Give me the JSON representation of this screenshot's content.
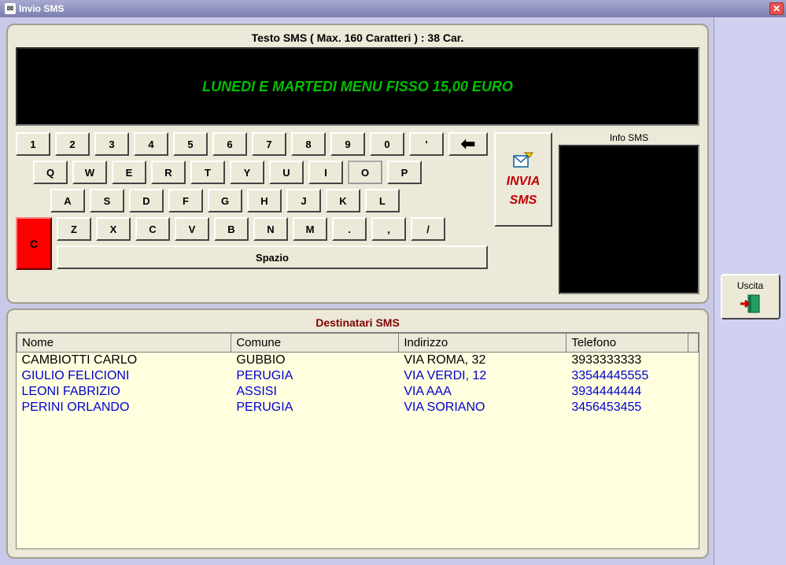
{
  "window": {
    "title": "Invio SMS"
  },
  "sms": {
    "header": "Testo SMS ( Max. 160 Caratteri ) : 38 Car.",
    "text": "LUNEDI E MARTEDI MENU FISSO 15,00 EURO"
  },
  "keyboard": {
    "row1": [
      "1",
      "2",
      "3",
      "4",
      "5",
      "6",
      "7",
      "8",
      "9",
      "0",
      "'"
    ],
    "row2": [
      "Q",
      "W",
      "E",
      "R",
      "T",
      "Y",
      "U",
      "I",
      "O",
      "P"
    ],
    "row3": [
      "A",
      "S",
      "D",
      "F",
      "G",
      "H",
      "J",
      "K",
      "L"
    ],
    "row4": [
      "Z",
      "X",
      "C",
      "V",
      "B",
      "N",
      "M",
      ".",
      ",",
      "/"
    ],
    "c_key": "C",
    "space": "Spazio",
    "focused_key": "O"
  },
  "send": {
    "line1": "INVIA",
    "line2": "SMS"
  },
  "info": {
    "label": "Info SMS"
  },
  "recipients": {
    "title": "Destinatari SMS",
    "columns": [
      "Nome",
      "Comune",
      "Indirizzo",
      "Telefono"
    ],
    "rows": [
      {
        "nome": "CAMBIOTTI CARLO",
        "comune": "GUBBIO",
        "indirizzo": "VIA ROMA, 32",
        "telefono": "3933333333",
        "selected": true
      },
      {
        "nome": "GIULIO FELICIONI",
        "comune": "PERUGIA",
        "indirizzo": "VIA VERDI, 12",
        "telefono": "33544445555",
        "selected": false
      },
      {
        "nome": "LEONI FABRIZIO",
        "comune": "ASSISI",
        "indirizzo": "VIA AAA",
        "telefono": "3934444444",
        "selected": false
      },
      {
        "nome": "PERINI ORLANDO",
        "comune": "PERUGIA",
        "indirizzo": "VIA SORIANO",
        "telefono": "3456453455",
        "selected": false
      }
    ]
  },
  "sidebar": {
    "uscita": "Uscita"
  }
}
